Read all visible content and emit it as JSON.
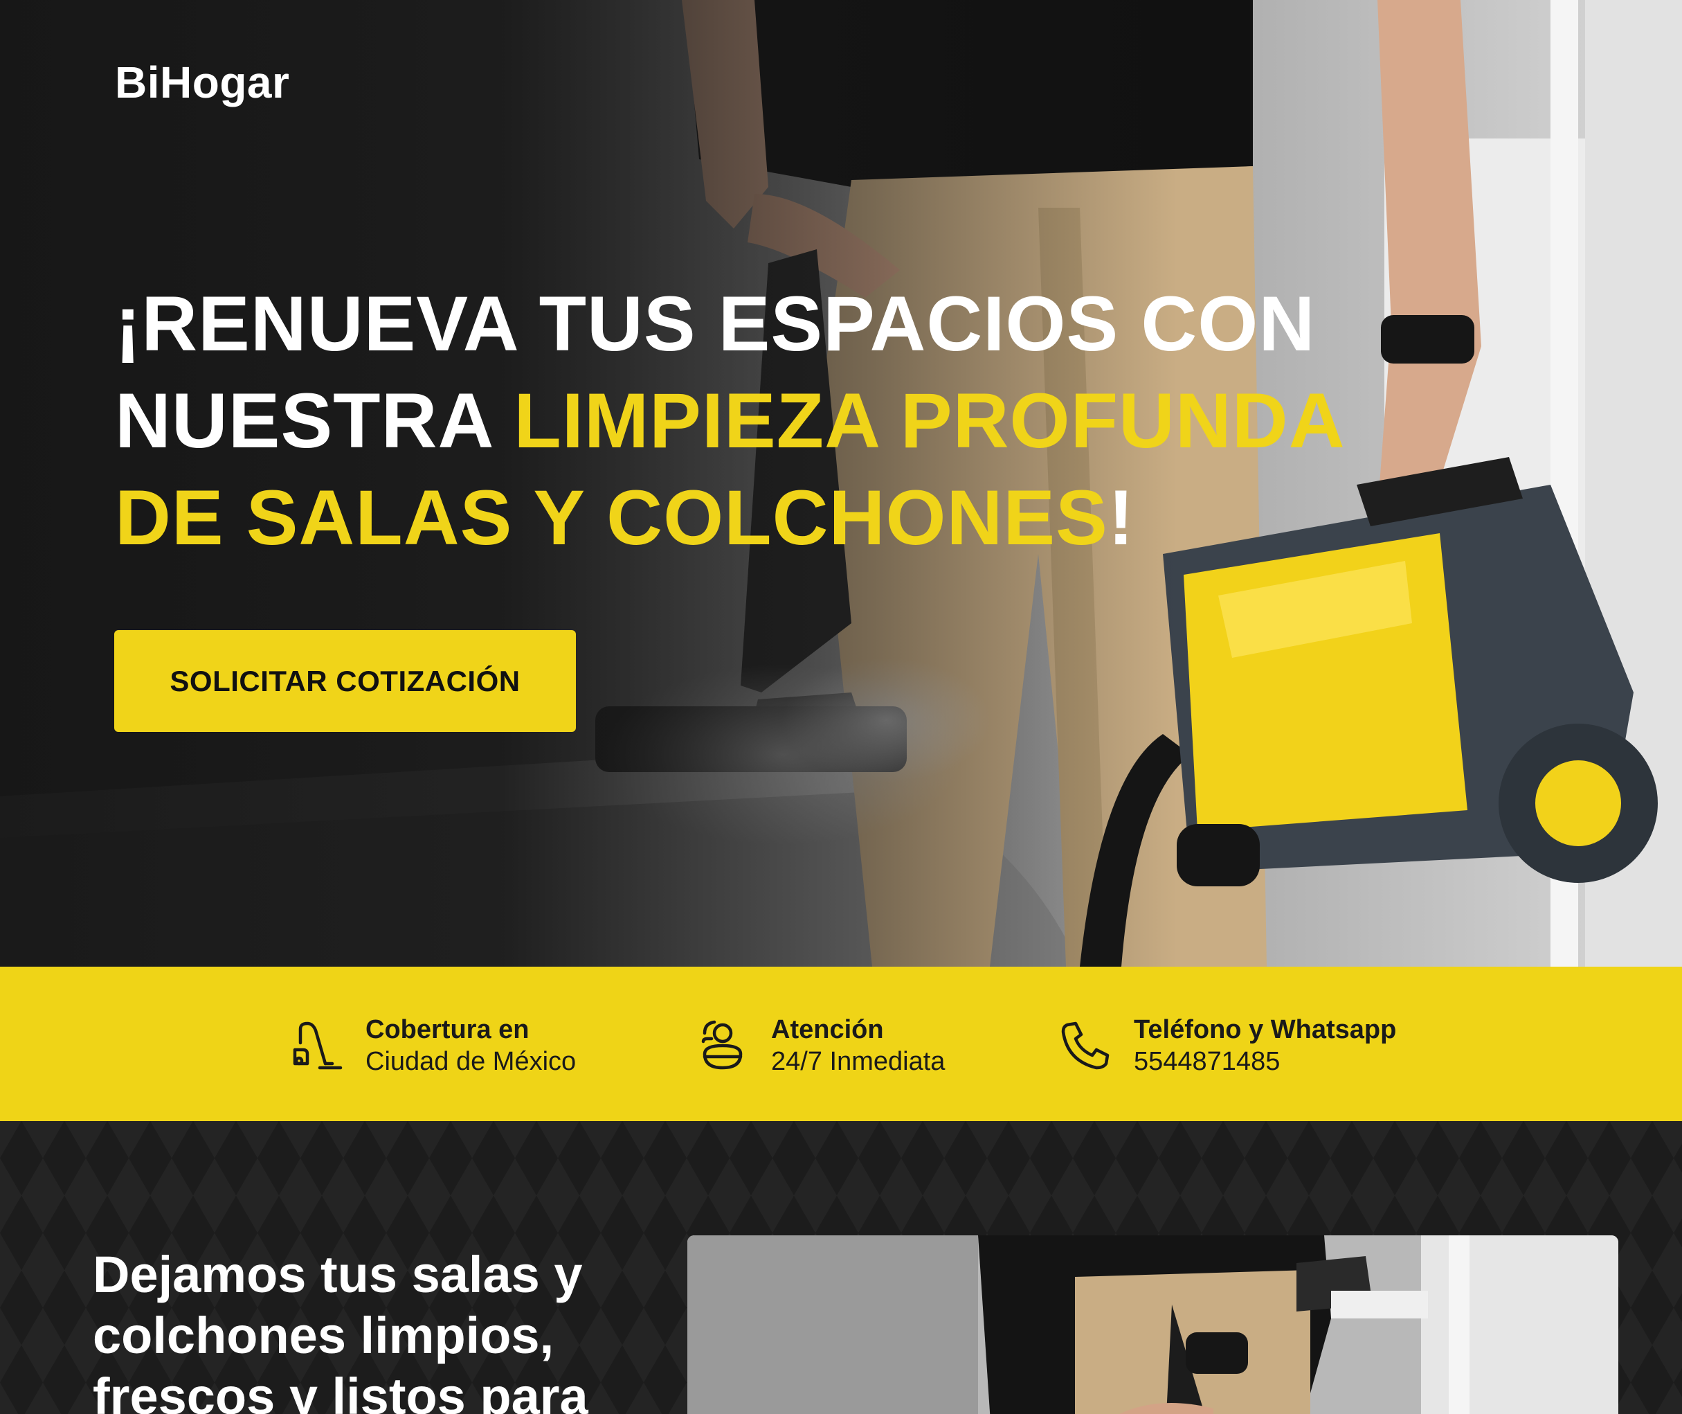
{
  "brand": {
    "name": "BiHogar"
  },
  "hero": {
    "headline": {
      "part1": "¡RENUEVA TUS ESPACIOS CON NUESTRA ",
      "highlight": "LIMPIEZA PROFUNDA DE SALAS Y COLCHONES",
      "part2": "!"
    },
    "cta_label": "SOLICITAR COTIZACIÓN"
  },
  "info_bar": {
    "items": [
      {
        "icon": "vacuum-cleaner-icon",
        "title": "Cobertura en",
        "subtitle": "Ciudad de México"
      },
      {
        "icon": "support-agent-icon",
        "title": "Atención",
        "subtitle": "24/7 Inmediata"
      },
      {
        "icon": "phone-icon",
        "title": "Teléfono y Whatsapp",
        "subtitle": "5544871485"
      }
    ]
  },
  "section2": {
    "title": "Dejamos tus salas y colchones limpios, frescos y listos para"
  },
  "colors": {
    "accent_yellow": "#f0d419",
    "dark_bg": "#1b1b1b",
    "text_white": "#ffffff",
    "text_dark": "#1a1a1a"
  }
}
